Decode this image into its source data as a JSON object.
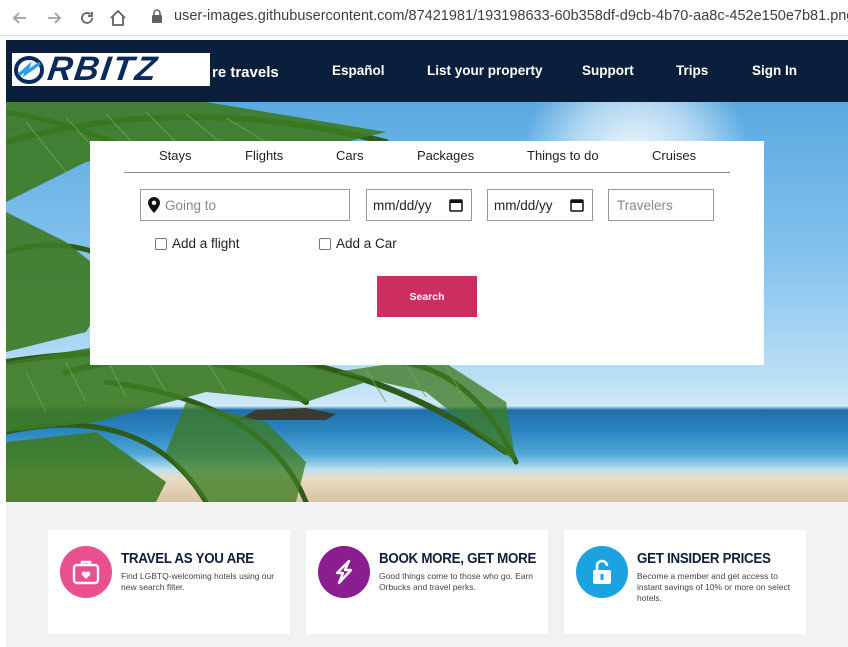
{
  "browser": {
    "url": "user-images.githubusercontent.com/87421981/193198633-60b358df-d9cb-4b70-aa8c-452e150e7b81.png"
  },
  "header": {
    "logo_text": "RBITZ",
    "tagline": "re travels",
    "nav": [
      "Español",
      "List your property",
      "Support",
      "Trips",
      "Sign In"
    ]
  },
  "search": {
    "tabs": [
      "Stays",
      "Flights",
      "Cars",
      "Packages",
      "Things to do",
      "Cruises"
    ],
    "going_to_placeholder": "Going to",
    "checkin_value": "mm/dd/yy",
    "checkout_value": "mm/dd/yy",
    "travelers_placeholder": "Travelers",
    "add_flight_label": "Add a flight",
    "add_car_label": "Add a Car",
    "search_label": "Search"
  },
  "promos": [
    {
      "title": "TRAVEL AS YOU ARE",
      "desc": "Find LGBTQ-welcoming hotels using our new search filter.",
      "color": "#e8508f",
      "icon": "suitcase-heart-icon"
    },
    {
      "title": "BOOK MORE, GET MORE",
      "desc": "Good things come to those who go. Earn Orbucks and travel perks.",
      "color": "#8a1d8f",
      "icon": "orbucks-icon"
    },
    {
      "title": "GET INSIDER PRICES",
      "desc": "Become a member and get access to instant savings of 10% or more on select hotels.",
      "color": "#1aa3e0",
      "icon": "lock-icon"
    }
  ],
  "colors": {
    "header_bg": "#0a1f3c",
    "search_button": "#cc2e5f"
  }
}
